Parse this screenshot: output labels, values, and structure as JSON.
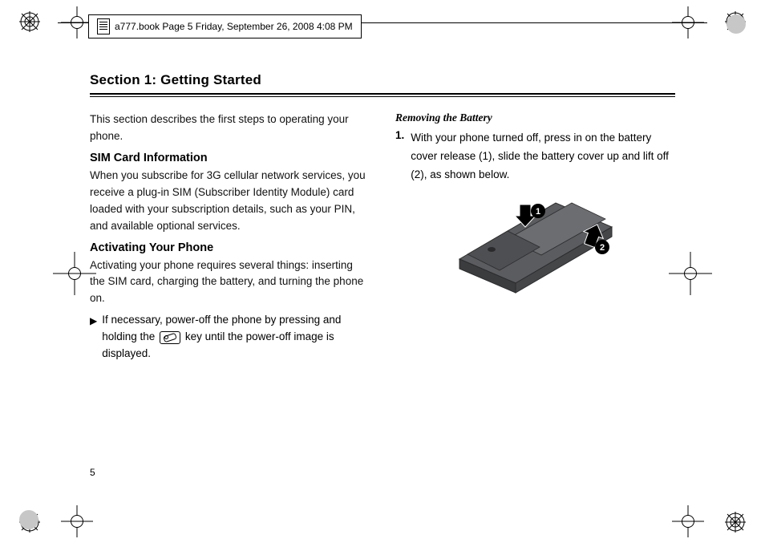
{
  "header_slug": "a777.book  Page 5  Friday, September 26, 2008  4:08 PM",
  "section_title": "Section 1: Getting Started",
  "page_number": "5",
  "left": {
    "intro": "This section describes the first steps to operating your phone.",
    "h_sim": "SIM Card Information",
    "p_sim": "When you subscribe for 3G cellular network services, you receive a plug-in SIM (Subscriber Identity Module) card loaded with your subscription details, such as your PIN, and available optional services.",
    "h_act": "Activating Your Phone",
    "p_act": "Activating your phone requires several things: inserting the SIM card, charging the battery, and turning the phone on.",
    "bullet_before_key": "If necessary, power-off the phone by pressing and holding the",
    "bullet_after_key": "key until the power-off image is displayed."
  },
  "right": {
    "h_remove": "Removing the Battery",
    "step1_num": "1.",
    "step1_text": "With your phone turned off, press in on the battery cover release (1), slide the battery cover up and lift off (2), as shown below.",
    "figure_label_1": "1",
    "figure_label_2": "2"
  }
}
